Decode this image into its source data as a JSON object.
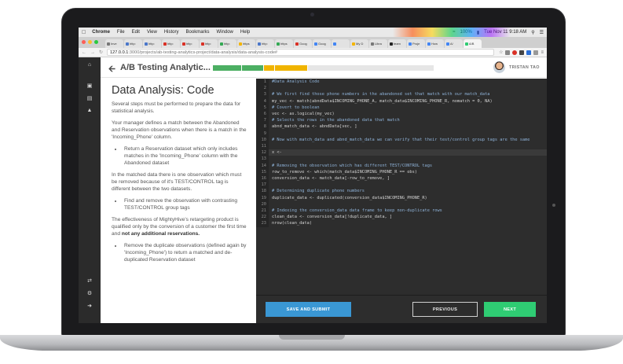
{
  "menubar": {
    "app": "Chrome",
    "items": [
      "File",
      "Edit",
      "View",
      "History",
      "Bookmarks",
      "Window",
      "Help"
    ],
    "battery": "100%",
    "datetime": "Tue Nov 11  9:18 AM"
  },
  "tabs": [
    {
      "label": "Inve",
      "color": "#777777"
    },
    {
      "label": "http:",
      "color": "#4a76c9"
    },
    {
      "label": "http:",
      "color": "#4a76c9"
    },
    {
      "label": "http:",
      "color": "#d93025"
    },
    {
      "label": "http:",
      "color": "#d93025"
    },
    {
      "label": "http:",
      "color": "#d93025"
    },
    {
      "label": "http:",
      "color": "#34a853"
    },
    {
      "label": "https",
      "color": "#f4b400"
    },
    {
      "label": "http:",
      "color": "#4a76c9"
    },
    {
      "label": "https",
      "color": "#34a853"
    },
    {
      "label": "Goog",
      "color": "#d93025"
    },
    {
      "label": "Goog",
      "color": "#4285f4"
    },
    {
      "label": "",
      "color": "#4285f4"
    },
    {
      "label": "My D",
      "color": "#f4b400"
    },
    {
      "label": "Libra",
      "color": "#777777"
    },
    {
      "label": "team",
      "color": "#222222"
    },
    {
      "label": "Proje",
      "color": "#4285f4"
    },
    {
      "label": "How",
      "color": "#4285f4"
    },
    {
      "label": "A/",
      "color": "#4285f4"
    },
    {
      "label": "A/B",
      "color": "#2fcc73"
    }
  ],
  "address": {
    "host": "127.0.0.1",
    "path": ":3000/projects/ab-testing-analytics-project/data-analysis/data-analysis-code#"
  },
  "header": {
    "back_icon": "back-arrow-icon",
    "title": "A/B Testing Analytic...",
    "progress": [
      {
        "fraction": 0.13,
        "color": "#4caf63"
      },
      {
        "fraction": 0.1,
        "color": "#4caf63"
      },
      {
        "fraction": 0.05,
        "color": "#f0b400"
      },
      {
        "fraction": 0.15,
        "color": "#f0b400"
      },
      {
        "fraction": 0.57,
        "color": "#e6e6e6"
      }
    ],
    "user_name": "TRISTAN TAO"
  },
  "instructions": {
    "title": "Data Analysis: Code",
    "p1": "Several steps must be performed to prepare the data for statistical analysis.",
    "p2": "Your manager defines a match between the Abandoned and Reservation observations when there is a match in the 'Incoming_Phone' column.",
    "b1": "Return a Reservation dataset which only includes matches in the 'Incoming_Phone' column with the Abandoned dataset",
    "p3": "In the matched data there is one observation which must be removed because of it's TEST/CONTROL tag is different between the two datasets.",
    "b2": "Find and remove the observation with contrasting TEST/CONTROL group tags",
    "p4a": "The effectiveness of MightyHive's retargeting product is qualified only by the conversion of a customer the first time and ",
    "p4b": "not any additional reservations.",
    "b3": "Remove the duplicate observations (defined again by 'Incoming_Phone') to return a matched and de-duplicated Reservation dataset"
  },
  "code": [
    {
      "n": "1",
      "text": "#Data Analysis Code",
      "comment": true
    },
    {
      "n": "2",
      "text": "",
      "comment": false
    },
    {
      "n": "3",
      "text": "# We first find those phone numbers in the abandoned set that match with our match_data",
      "comment": true
    },
    {
      "n": "4",
      "text": "my_vec <- match(abndData$INCOMING_PHONE_A, match_data$INCOMING_PHONE_R, nomatch = 0, NA)",
      "comment": false
    },
    {
      "n": "5",
      "text": "# Covert to boolean",
      "comment": true
    },
    {
      "n": "6",
      "text": "vec <- as.logical(my_vec)",
      "comment": false
    },
    {
      "n": "7",
      "text": "# Selects the rows in the abandoned data that match",
      "comment": true
    },
    {
      "n": "8",
      "text": "abnd_match_data <- abndData[vec, ]",
      "comment": false
    },
    {
      "n": "9",
      "text": "",
      "comment": false
    },
    {
      "n": "10",
      "text": "# Now with match_data and abnd_match_data we can verify that their test/control group tags are the same",
      "comment": true
    },
    {
      "n": "11",
      "text": "",
      "comment": false
    },
    {
      "n": "12",
      "text": "x <-",
      "comment": false
    },
    {
      "n": "13",
      "text": "",
      "comment": false
    },
    {
      "n": "14",
      "text": "# Removing the observation which has different TEST/CONTROL tags",
      "comment": true
    },
    {
      "n": "15",
      "text": "row_to_remove <- which(match_data$INCOMING_PHONE_R == obs)",
      "comment": false
    },
    {
      "n": "16",
      "text": "conversion_data <- match_data[-row_to_remove, ]",
      "comment": false
    },
    {
      "n": "17",
      "text": "",
      "comment": false
    },
    {
      "n": "18",
      "text": "# Determining duplicate phone numbers",
      "comment": true
    },
    {
      "n": "19",
      "text": "duplicate_data <- duplicated(conversion_data$INCOMING_PHONE_R)",
      "comment": false
    },
    {
      "n": "20",
      "text": "",
      "comment": false
    },
    {
      "n": "21",
      "text": "# Indexing the conversion_data data frame to keep non-duplicate rows",
      "comment": true
    },
    {
      "n": "22",
      "text": "clean_data <- conversion_data[!duplicate_data, ]",
      "comment": false
    },
    {
      "n": "23",
      "text": "nrow(clean_data)",
      "comment": false
    }
  ],
  "current_line": "12",
  "footer": {
    "submit_label": "SAVE AND SUBMIT",
    "prev_label": "PREVIOUS",
    "next_label": "NEXT"
  }
}
